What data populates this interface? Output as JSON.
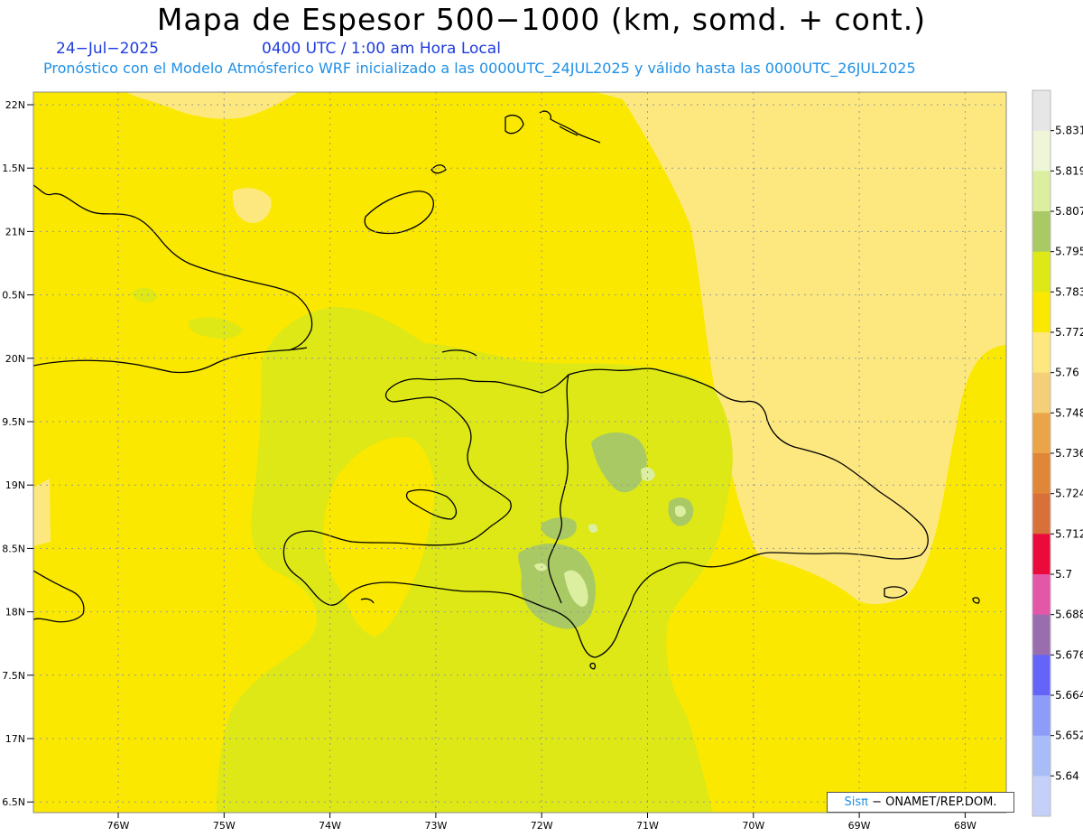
{
  "title": "Mapa de Espesor 500−1000 (km, somd. + cont.)",
  "date": "24−Jul−2025",
  "valid_time": "0400 UTC / 1:00 am Hora Local",
  "subtitle": "Pronóstico con el Modelo Atmósferico WRF inicializado a las 0000UTC_24JUL2025 y válido hasta las  0000UTC_26JUL2025",
  "credit": {
    "sis": "Sisπ",
    "rest": "− ONAMET/REP.DOM."
  },
  "lat_labels": [
    "22N",
    "1.5N",
    "21N",
    "0.5N",
    "20N",
    "9.5N",
    "19N",
    "8.5N",
    "18N",
    "7.5N",
    "17N",
    "6.5N"
  ],
  "lon_labels": [
    "76W",
    "75W",
    "74W",
    "73W",
    "72W",
    "71W",
    "70W",
    "69W",
    "68W"
  ],
  "colorbar": {
    "labels": [
      "5.831",
      "5.819",
      "5.807",
      "5.795",
      "5.783",
      "5.772",
      "5.76",
      "5.748",
      "5.736",
      "5.724",
      "5.712",
      "5.7",
      "5.688",
      "5.676",
      "5.664",
      "5.652",
      "5.64"
    ],
    "colors": [
      "#e6e6e6",
      "#eef5d8",
      "#dcefa0",
      "#a9c964",
      "#dde816",
      "#fbe800",
      "#fde880",
      "#f5cf78",
      "#eba448",
      "#e08638",
      "#d8703a",
      "#ea0a3c",
      "#e456a8",
      "#9a6eae",
      "#6464f8",
      "#8c9cf8",
      "#a8bcf8",
      "#c4d0f8"
    ]
  },
  "fill_colors": {
    "light_yellow": "#fde880",
    "yellow": "#fbe800",
    "yellow_green": "#dde816",
    "green": "#a9c964",
    "pale_green": "#dcefa0"
  }
}
